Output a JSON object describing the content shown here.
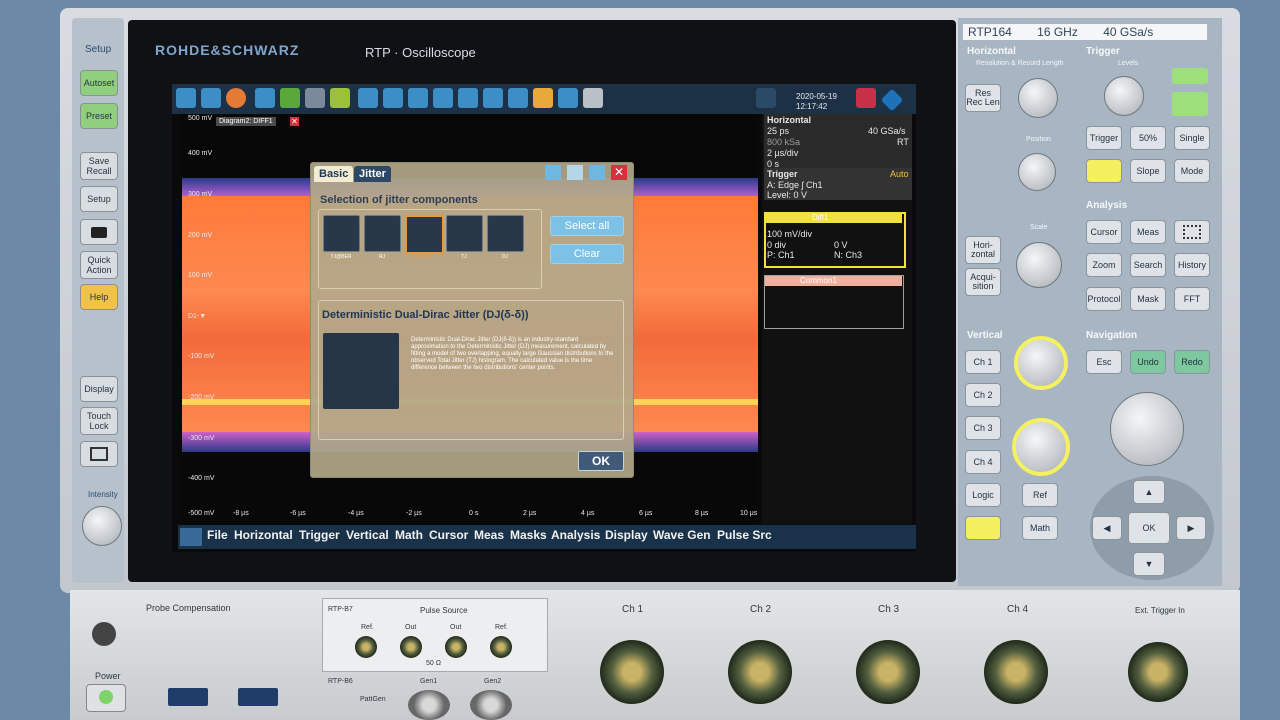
{
  "brand": "ROHDE&SCHWARZ",
  "model_title": "RTP · Oscilloscope",
  "left_panel": {
    "setup_label": "Setup",
    "buttons": [
      "Autoset",
      "Preset",
      "Save Recall",
      "Setup",
      "",
      "Quick Action",
      "Help",
      "Display",
      "Touch Lock",
      ""
    ],
    "intensity_label": "Intensity"
  },
  "toolbar": {
    "date": "2020-05-19",
    "time": "12:17:42"
  },
  "waveform": {
    "y_labels": [
      "500 mV",
      "400 mV",
      "300 mV",
      "200 mV",
      "100 mV",
      "D1-▼",
      "-100 mV",
      "-200 mV",
      "-300 mV",
      "-400 mV",
      "-500 mV"
    ],
    "x_labels": [
      "-8 µs",
      "-6 µs",
      "-4 µs",
      "-2 µs",
      "0 s",
      "2 µs",
      "4 µs",
      "6 µs",
      "8 µs",
      "10 µs"
    ],
    "diagram_tab": "Diagram2: DIFF1"
  },
  "side_panel": {
    "horizontal_title": "Horizontal",
    "h_line1_left": "25 ps",
    "h_line1_right": "40 GSa/s",
    "h_line2_left": "800 kSa",
    "h_line2_right": "RT",
    "h_line3": "2 µs/div",
    "h_line4": "0 s",
    "trigger_title": "Trigger",
    "trigger_mode": "Auto",
    "trigger_line1": "A:   Edge ʃ Ch1",
    "trigger_line2": "Level: 0 V",
    "diff_title": "Diff1",
    "diff_line1": "100 mV/div",
    "diff_line2_left": "0 div",
    "diff_line2_right": "0 V",
    "diff_line3_left": "P: Ch1",
    "diff_line3_right": "N: Ch3",
    "common_title": "Common1"
  },
  "dialog": {
    "tab_basic": "Basic",
    "tab_jitter": "Jitter",
    "section_title": "Selection of jitter components",
    "components": [
      "TJ@BER",
      "RJ",
      "DJ (δ-δ)",
      "TJ",
      "DJ"
    ],
    "select_all": "Select all",
    "clear": "Clear",
    "desc_title": "Deterministic Dual-Dirac Jitter (DJ(δ-δ))",
    "desc_text": "Deterministic Dual-Dirac Jitter (DJ(δ-δ)) is an industry-standard approximation to the Deterministic Jitter (DJ) measurement, calculated by fitting a model of two overlapping, equally large Gaussian distributions to the observed Total Jitter (TJ) histogram. The calculated value is the time difference between the two distributions' center points.",
    "ok": "OK"
  },
  "menu": [
    "File",
    "Horizontal",
    "Trigger",
    "Vertical",
    "Math",
    "Cursor",
    "Meas",
    "Masks",
    "Analysis",
    "Display",
    "Wave Gen",
    "Pulse Src"
  ],
  "right_panel": {
    "model": "RTP164",
    "bandwidth": "16 GHz",
    "sample_rate": "40 GSa/s",
    "horizontal": "Horizontal",
    "resolution": "Resolution  &  Record Length",
    "res_rec_len": "Res Rec Len",
    "position": "Position",
    "scale": "Scale",
    "horizontal_btn": "Hori- zontal",
    "acquisition_btn": "Acqui- sition",
    "trigger": "Trigger",
    "levels": "Levels",
    "trigger_buttons": [
      "Trigger",
      "50%",
      "Single",
      "",
      "Slope",
      "Mode"
    ],
    "analysis": "Analysis",
    "analysis_buttons": [
      "Cursor",
      "Meas",
      "",
      "Zoom",
      "Search",
      "History",
      "Protocol",
      "Mask",
      "FFT"
    ],
    "vertical": "Vertical",
    "channel_buttons": [
      "Ch 1",
      "Ch 2",
      "Ch 3",
      "Ch 4",
      "Logic",
      "Ref",
      "",
      "Math"
    ],
    "navigation": "Navigation",
    "nav_buttons": [
      "Esc",
      "Undo",
      "Redo"
    ],
    "ok_btn": "OK"
  },
  "bottom": {
    "probe_comp": "Probe Compensation",
    "power": "Power",
    "rtp_b7": "RTP-B7",
    "pulse_source": "Pulse Source",
    "ref1": "Ref.",
    "out1": "Out",
    "out2": "Out",
    "ref2": "Ref.",
    "ohm": "50 Ω",
    "rtp_b6": "RTP-B6",
    "pattgen": "PattGen",
    "gen1": "Gen1",
    "gen2": "Gen2",
    "ch1": "Ch 1",
    "ch2": "Ch 2",
    "ch3": "Ch 3",
    "ch4": "Ch 4",
    "ext_trigger": "Ext. Trigger In"
  }
}
